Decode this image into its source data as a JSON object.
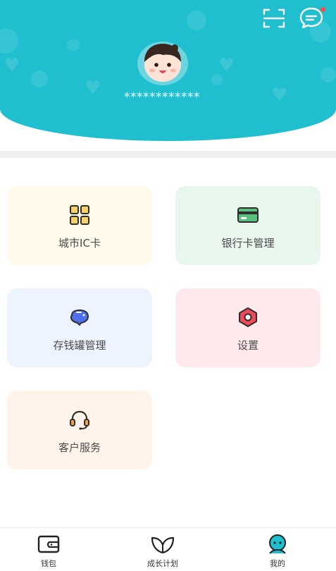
{
  "header": {
    "username": "************",
    "icons": {
      "scan": "scan-icon",
      "message": "message-icon",
      "avatar": "avatar-face-icon"
    },
    "has_unread_message": true
  },
  "menu": [
    {
      "id": "city-ic-card",
      "label": "城市IC卡",
      "icon": "grid-icon"
    },
    {
      "id": "bank-card",
      "label": "银行卡管理",
      "icon": "bank-card-icon"
    },
    {
      "id": "piggy-bank",
      "label": "存钱罐管理",
      "icon": "piggy-bank-icon"
    },
    {
      "id": "settings",
      "label": "设置",
      "icon": "hexagon-settings-icon"
    },
    {
      "id": "customer-service",
      "label": "客户服务",
      "icon": "headset-icon"
    }
  ],
  "bottom_nav": [
    {
      "id": "wallet",
      "label": "钱包",
      "icon": "wallet-icon"
    },
    {
      "id": "growth",
      "label": "成长计划",
      "icon": "growth-leaf-icon"
    },
    {
      "id": "mine",
      "label": "我的",
      "icon": "profile-icon",
      "active": true
    }
  ],
  "colors": {
    "header_bg": "#1fbfd0",
    "accent": "#1fbfd0",
    "alert_dot": "#ff4a4a",
    "ic_card_bg": "#fffaea",
    "bank_card_bg": "#e9f6ee",
    "piggy_card_bg": "#eef4ff",
    "settings_card_bg": "#ffe9ec",
    "service_card_bg": "#fff3ea"
  }
}
